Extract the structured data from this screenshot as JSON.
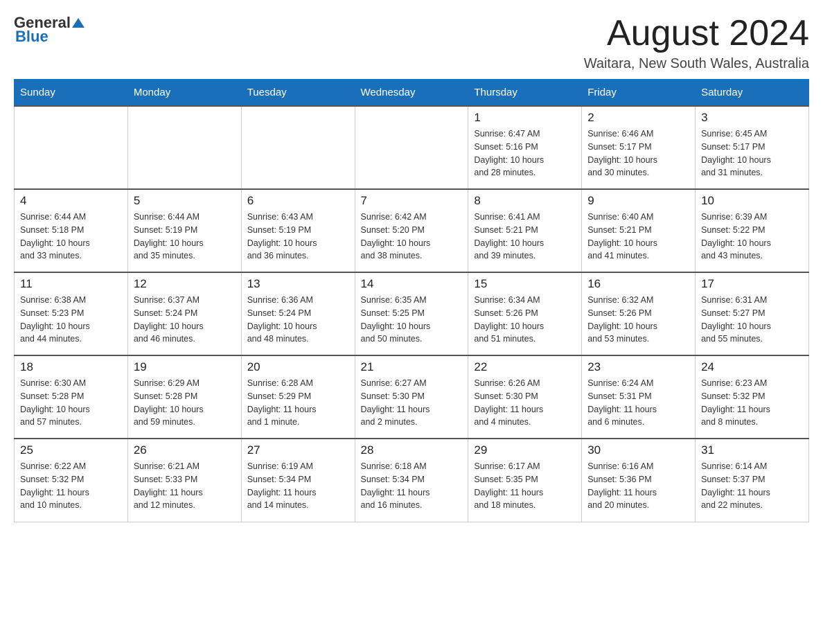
{
  "header": {
    "logo_general": "General",
    "logo_blue": "Blue",
    "title": "August 2024",
    "location": "Waitara, New South Wales, Australia"
  },
  "days_of_week": [
    "Sunday",
    "Monday",
    "Tuesday",
    "Wednesday",
    "Thursday",
    "Friday",
    "Saturday"
  ],
  "weeks": [
    {
      "days": [
        {
          "num": "",
          "info": ""
        },
        {
          "num": "",
          "info": ""
        },
        {
          "num": "",
          "info": ""
        },
        {
          "num": "",
          "info": ""
        },
        {
          "num": "1",
          "info": "Sunrise: 6:47 AM\nSunset: 5:16 PM\nDaylight: 10 hours\nand 28 minutes."
        },
        {
          "num": "2",
          "info": "Sunrise: 6:46 AM\nSunset: 5:17 PM\nDaylight: 10 hours\nand 30 minutes."
        },
        {
          "num": "3",
          "info": "Sunrise: 6:45 AM\nSunset: 5:17 PM\nDaylight: 10 hours\nand 31 minutes."
        }
      ]
    },
    {
      "days": [
        {
          "num": "4",
          "info": "Sunrise: 6:44 AM\nSunset: 5:18 PM\nDaylight: 10 hours\nand 33 minutes."
        },
        {
          "num": "5",
          "info": "Sunrise: 6:44 AM\nSunset: 5:19 PM\nDaylight: 10 hours\nand 35 minutes."
        },
        {
          "num": "6",
          "info": "Sunrise: 6:43 AM\nSunset: 5:19 PM\nDaylight: 10 hours\nand 36 minutes."
        },
        {
          "num": "7",
          "info": "Sunrise: 6:42 AM\nSunset: 5:20 PM\nDaylight: 10 hours\nand 38 minutes."
        },
        {
          "num": "8",
          "info": "Sunrise: 6:41 AM\nSunset: 5:21 PM\nDaylight: 10 hours\nand 39 minutes."
        },
        {
          "num": "9",
          "info": "Sunrise: 6:40 AM\nSunset: 5:21 PM\nDaylight: 10 hours\nand 41 minutes."
        },
        {
          "num": "10",
          "info": "Sunrise: 6:39 AM\nSunset: 5:22 PM\nDaylight: 10 hours\nand 43 minutes."
        }
      ]
    },
    {
      "days": [
        {
          "num": "11",
          "info": "Sunrise: 6:38 AM\nSunset: 5:23 PM\nDaylight: 10 hours\nand 44 minutes."
        },
        {
          "num": "12",
          "info": "Sunrise: 6:37 AM\nSunset: 5:24 PM\nDaylight: 10 hours\nand 46 minutes."
        },
        {
          "num": "13",
          "info": "Sunrise: 6:36 AM\nSunset: 5:24 PM\nDaylight: 10 hours\nand 48 minutes."
        },
        {
          "num": "14",
          "info": "Sunrise: 6:35 AM\nSunset: 5:25 PM\nDaylight: 10 hours\nand 50 minutes."
        },
        {
          "num": "15",
          "info": "Sunrise: 6:34 AM\nSunset: 5:26 PM\nDaylight: 10 hours\nand 51 minutes."
        },
        {
          "num": "16",
          "info": "Sunrise: 6:32 AM\nSunset: 5:26 PM\nDaylight: 10 hours\nand 53 minutes."
        },
        {
          "num": "17",
          "info": "Sunrise: 6:31 AM\nSunset: 5:27 PM\nDaylight: 10 hours\nand 55 minutes."
        }
      ]
    },
    {
      "days": [
        {
          "num": "18",
          "info": "Sunrise: 6:30 AM\nSunset: 5:28 PM\nDaylight: 10 hours\nand 57 minutes."
        },
        {
          "num": "19",
          "info": "Sunrise: 6:29 AM\nSunset: 5:28 PM\nDaylight: 10 hours\nand 59 minutes."
        },
        {
          "num": "20",
          "info": "Sunrise: 6:28 AM\nSunset: 5:29 PM\nDaylight: 11 hours\nand 1 minute."
        },
        {
          "num": "21",
          "info": "Sunrise: 6:27 AM\nSunset: 5:30 PM\nDaylight: 11 hours\nand 2 minutes."
        },
        {
          "num": "22",
          "info": "Sunrise: 6:26 AM\nSunset: 5:30 PM\nDaylight: 11 hours\nand 4 minutes."
        },
        {
          "num": "23",
          "info": "Sunrise: 6:24 AM\nSunset: 5:31 PM\nDaylight: 11 hours\nand 6 minutes."
        },
        {
          "num": "24",
          "info": "Sunrise: 6:23 AM\nSunset: 5:32 PM\nDaylight: 11 hours\nand 8 minutes."
        }
      ]
    },
    {
      "days": [
        {
          "num": "25",
          "info": "Sunrise: 6:22 AM\nSunset: 5:32 PM\nDaylight: 11 hours\nand 10 minutes."
        },
        {
          "num": "26",
          "info": "Sunrise: 6:21 AM\nSunset: 5:33 PM\nDaylight: 11 hours\nand 12 minutes."
        },
        {
          "num": "27",
          "info": "Sunrise: 6:19 AM\nSunset: 5:34 PM\nDaylight: 11 hours\nand 14 minutes."
        },
        {
          "num": "28",
          "info": "Sunrise: 6:18 AM\nSunset: 5:34 PM\nDaylight: 11 hours\nand 16 minutes."
        },
        {
          "num": "29",
          "info": "Sunrise: 6:17 AM\nSunset: 5:35 PM\nDaylight: 11 hours\nand 18 minutes."
        },
        {
          "num": "30",
          "info": "Sunrise: 6:16 AM\nSunset: 5:36 PM\nDaylight: 11 hours\nand 20 minutes."
        },
        {
          "num": "31",
          "info": "Sunrise: 6:14 AM\nSunset: 5:37 PM\nDaylight: 11 hours\nand 22 minutes."
        }
      ]
    }
  ]
}
